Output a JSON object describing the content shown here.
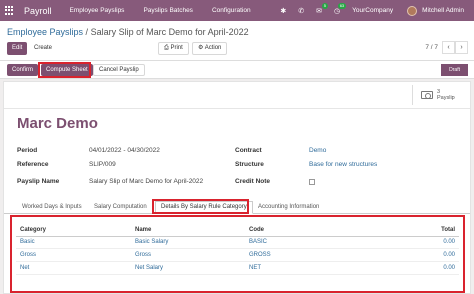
{
  "navbar": {
    "app_title": "Payroll",
    "menu": [
      "Employee Payslips",
      "Payslips Batches",
      "Configuration"
    ],
    "chat_badge": "5",
    "activity_badge": "63",
    "company": "YourCompany",
    "user": "Mitchell Admin"
  },
  "breadcrumb": {
    "parent": "Employee Payslips",
    "separator": " / ",
    "current": "Salary Slip of Marc Demo for April-2022"
  },
  "toolbar": {
    "edit": "Edit",
    "create": "Create",
    "print": "Print",
    "action": "Action",
    "pager": "7 / 7"
  },
  "statusbar": {
    "confirm": "Confirm",
    "compute_sheet": "Compute Sheet",
    "cancel_payslip": "Cancel Payslip",
    "state": "Draft"
  },
  "smart_button": {
    "count": "3",
    "label": "Payslip"
  },
  "employee_name": "Marc Demo",
  "fields": {
    "period_label": "Period",
    "period_from": "04/01/2022",
    "period_sep": " - ",
    "period_to": "04/30/2022",
    "reference_label": "Reference",
    "reference": "SLIP/009",
    "payslip_name_label": "Payslip Name",
    "payslip_name": "Salary Slip of Marc Demo for April-2022",
    "contract_label": "Contract",
    "contract": "Demo",
    "structure_label": "Structure",
    "structure": "Base for new structures",
    "credit_note_label": "Credit Note"
  },
  "tabs": [
    "Worked Days & Inputs",
    "Salary Computation",
    "Details By Salary Rule Category",
    "Accounting Information"
  ],
  "table": {
    "headers": [
      "Category",
      "Name",
      "Code",
      "Total"
    ],
    "rows": [
      {
        "category": "Basic",
        "name": "Basic Salary",
        "code": "BASIC",
        "total": "0.00"
      },
      {
        "category": "Gross",
        "name": "Gross",
        "code": "GROSS",
        "total": "0.00"
      },
      {
        "category": "Net",
        "name": "Net Salary",
        "code": "NET",
        "total": "0.00"
      }
    ]
  },
  "colors": {
    "brand": "#875a7b",
    "primary_button": "#7c4f70",
    "link": "#2f6b9a",
    "highlight": "#d9232e"
  }
}
